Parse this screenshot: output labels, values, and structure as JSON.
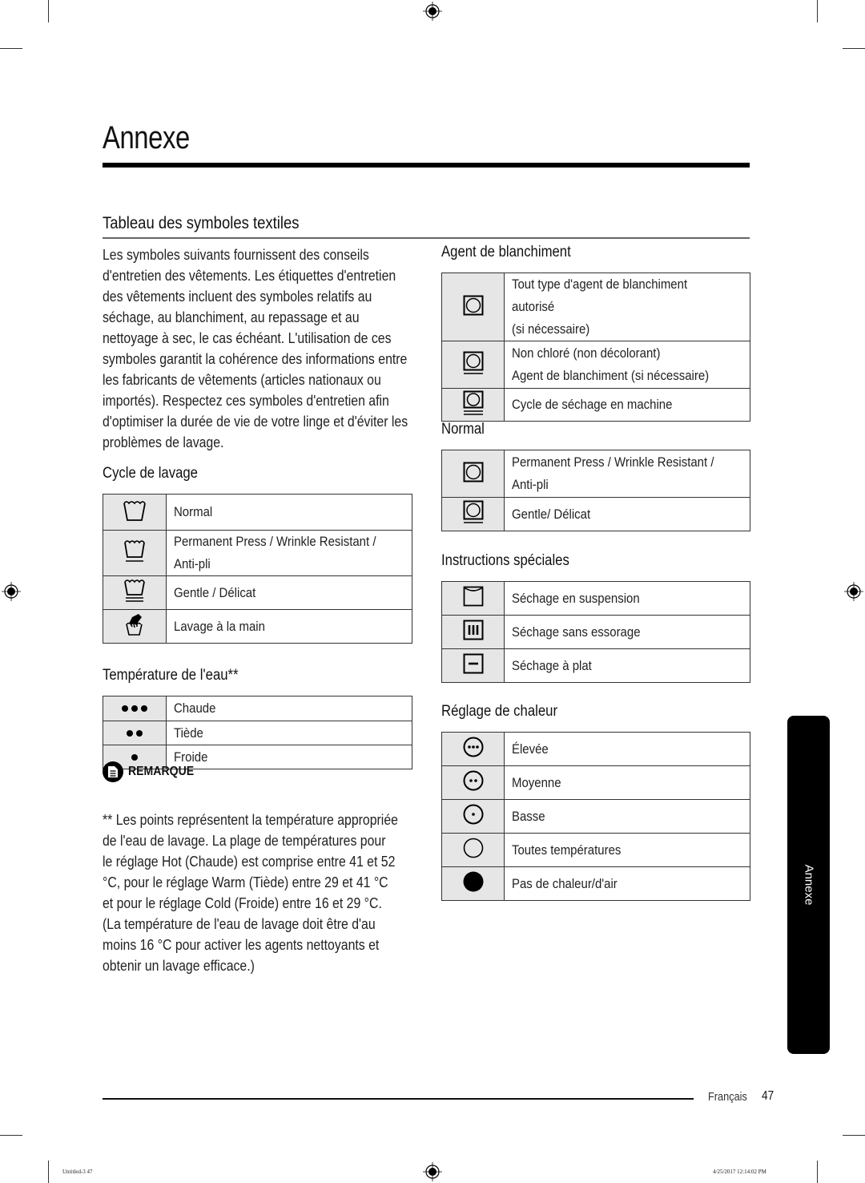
{
  "page": {
    "title": "Annexe",
    "section_title": "Tableau des symboles textiles",
    "intro": "Les symboles suivants fournissent des conseils d'entretien des vêtements. Les étiquettes d'entretien des vêtements incluent des symboles relatifs au séchage, au blanchiment, au repassage et au nettoyage à sec, le cas échéant. L'utilisation de ces symboles garantit la cohérence des informations entre les fabricants de vêtements (articles nationaux ou importés). Respectez ces symboles d'entretien afin d'optimiser la durée de vie de votre linge et d'éviter les problèmes de lavage."
  },
  "wash_cycle": {
    "heading": "Cycle de lavage",
    "rows": [
      {
        "icon": "washtub-normal-icon",
        "label": "Normal"
      },
      {
        "icon": "washtub-permanent-press-icon",
        "label": "Permanent Press / Wrinkle Resistant /\nAnti-pli"
      },
      {
        "icon": "washtub-gentle-icon",
        "label": "Gentle / Délicat"
      },
      {
        "icon": "hand-wash-icon",
        "label": "Lavage à la main"
      }
    ]
  },
  "water_temp": {
    "heading": "Température de l'eau**",
    "rows": [
      {
        "icon": "three-dots-icon",
        "label": "Chaude"
      },
      {
        "icon": "two-dots-icon",
        "label": "Tiède"
      },
      {
        "icon": "one-dot-icon",
        "label": "Froide"
      }
    ]
  },
  "note": {
    "heading": "REMARQUE",
    "text": "** Les points représentent la température appropriée de l'eau de lavage. La plage de températures pour le réglage Hot (Chaude) est comprise entre 41 et 52 °C, pour le réglage Warm (Tiède) entre 29 et 41 °C et pour le réglage Cold (Froide) entre 16 et 29 °C. (La température de l'eau de lavage doit être d'au moins 16 °C pour activer les agents nettoyants et obtenir un lavage efficace.)"
  },
  "bleach": {
    "heading": "Agent de blanchiment",
    "rows": [
      {
        "icon": "tumble-dry-icon",
        "label": "Tout type d'agent de blanchiment autorisé\n(si nécessaire)"
      },
      {
        "icon": "tumble-dry-one-bar-icon",
        "label": "Non chloré (non décolorant)\nAgent de blanchiment (si nécessaire)"
      },
      {
        "icon": "tumble-dry-two-bars-icon",
        "label": "Cycle de séchage en machine"
      }
    ]
  },
  "normal": {
    "heading": "Normal",
    "rows": [
      {
        "icon": "tumble-dry-icon",
        "label": "Permanent Press / Wrinkle Resistant /\nAnti-pli"
      },
      {
        "icon": "tumble-dry-one-bar-icon",
        "label": "Gentle/ Délicat"
      }
    ]
  },
  "special": {
    "heading": "Instructions spéciales",
    "rows": [
      {
        "icon": "line-dry-icon",
        "label": "Séchage en suspension"
      },
      {
        "icon": "drip-dry-icon",
        "label": "Séchage sans essorage"
      },
      {
        "icon": "dry-flat-icon",
        "label": "Séchage à plat"
      }
    ]
  },
  "heat": {
    "heading": "Réglage de chaleur",
    "rows": [
      {
        "icon": "heat-high-icon",
        "label": "Élevée"
      },
      {
        "icon": "heat-medium-icon",
        "label": "Moyenne"
      },
      {
        "icon": "heat-low-icon",
        "label": "Basse"
      },
      {
        "icon": "heat-any-icon",
        "label": "Toutes températures"
      },
      {
        "icon": "no-heat-icon",
        "label": "Pas de chaleur/d'air"
      }
    ]
  },
  "side_tab": {
    "label": "Annexe"
  },
  "footer": {
    "language": "Français",
    "page_number": "47"
  },
  "slug": {
    "left": "Untitled-3   47",
    "right": "4/25/2017   12:14:02 PM"
  }
}
